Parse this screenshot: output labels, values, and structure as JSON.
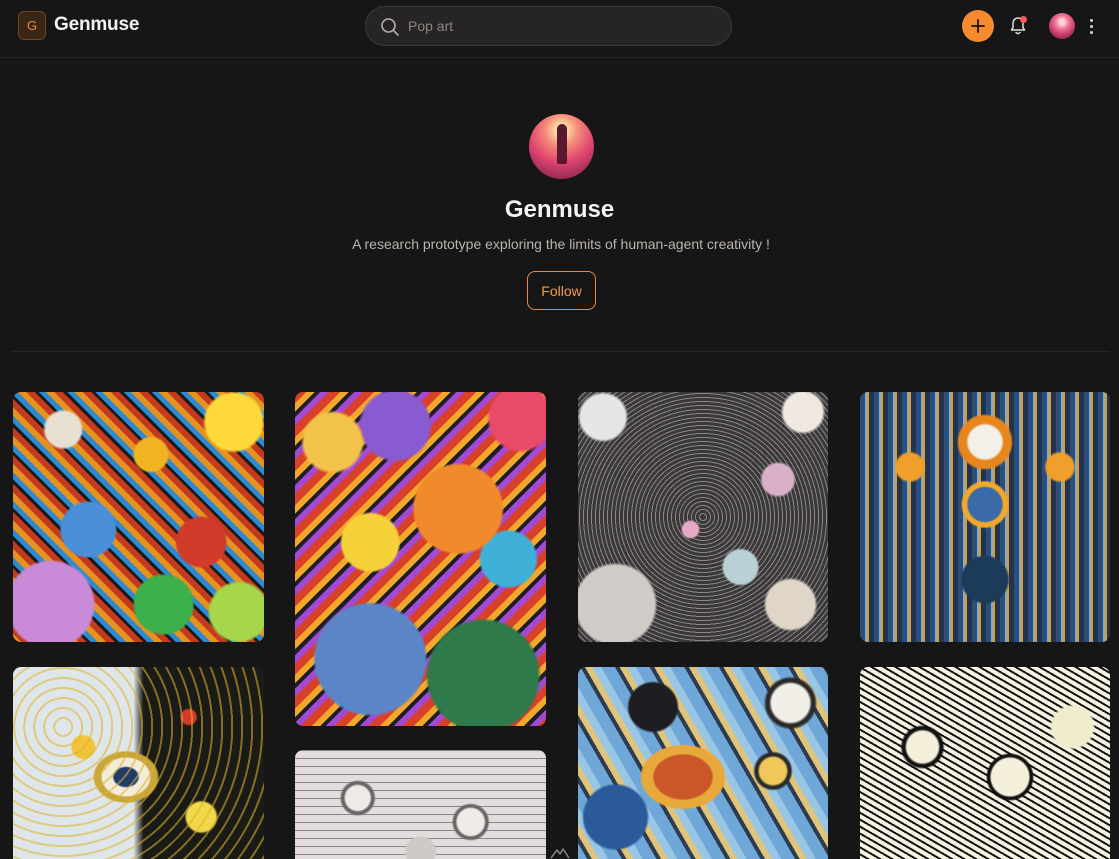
{
  "header": {
    "logo_letter": "G",
    "brand": "Genmuse",
    "search": {
      "placeholder": "Pop art"
    },
    "icons": [
      "search-icon",
      "plus-icon",
      "bell-icon",
      "avatar",
      "more-vertical-icon"
    ]
  },
  "profile": {
    "name": "Genmuse",
    "bio": "A research prototype exploring the limits of human-agent creativity !",
    "follow_label": "Follow"
  },
  "gallery": [
    {
      "style": "colorful doodle characters"
    },
    {
      "style": "psychedelic pop art creatures"
    },
    {
      "style": "planets and gears"
    },
    {
      "style": "blue and orange circuitry"
    },
    {
      "style": "yellow eye and dots"
    },
    {
      "style": "grey mechanical sketch"
    },
    {
      "style": "blue collage with clocks"
    },
    {
      "style": "black and white line art"
    }
  ],
  "colors": {
    "accent": "#f58a2e",
    "background": "#171616",
    "notification": "#ff5a5a"
  }
}
